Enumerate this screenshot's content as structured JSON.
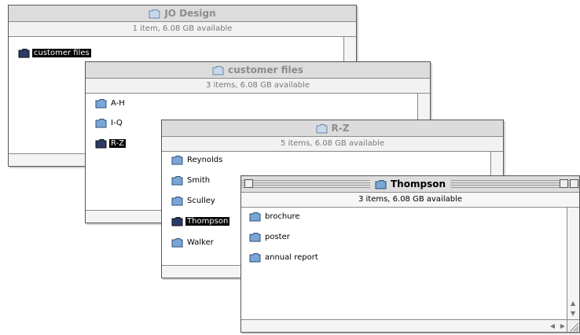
{
  "windows": {
    "jo": {
      "title": "JO Design",
      "info": "1 item, 6.08 GB available",
      "items": [
        {
          "label": "customer files",
          "selected": true
        }
      ]
    },
    "customer": {
      "title": "customer files",
      "info": "3 items, 6.08 GB available",
      "items": [
        {
          "label": "A-H"
        },
        {
          "label": "I-Q"
        },
        {
          "label": "R-Z",
          "selected": true
        }
      ]
    },
    "rz": {
      "title": "R-Z",
      "info": "5 items, 6.08 GB available",
      "items": [
        {
          "label": "Reynolds"
        },
        {
          "label": "Smith"
        },
        {
          "label": "Sculley"
        },
        {
          "label": "Thompson",
          "selected": true
        },
        {
          "label": "Walker"
        }
      ]
    },
    "thompson": {
      "title": "Thompson",
      "info": "3 items, 6.08 GB available",
      "items": [
        {
          "label": "brochure"
        },
        {
          "label": "poster"
        },
        {
          "label": "annual report"
        }
      ]
    }
  },
  "icons": {
    "folder": "folder-icon",
    "open_folder": "open-folder-icon"
  },
  "colors": {
    "titlebar": "#dedede",
    "selection": "#000000",
    "folder": "#7aa6d6"
  }
}
